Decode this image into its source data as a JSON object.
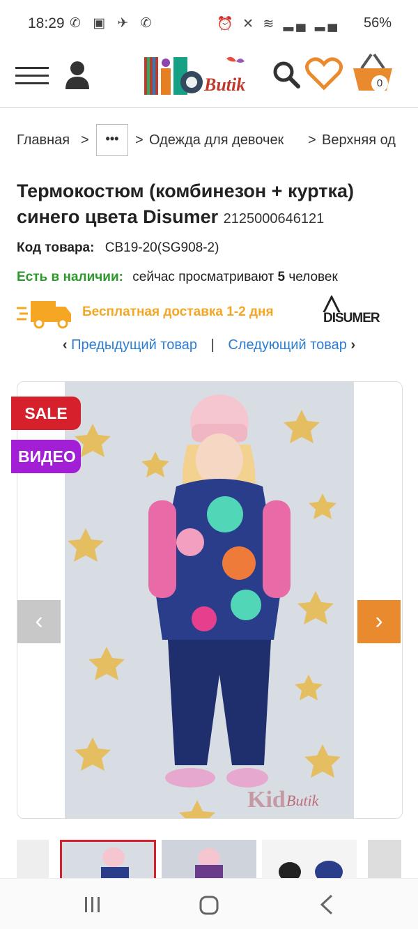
{
  "status": {
    "time": "18:29",
    "battery": "56%"
  },
  "header": {
    "logo_text_kid": "Kid",
    "logo_text_butik": "Butik",
    "cart_count": "0"
  },
  "breadcrumb": {
    "home": "Главная",
    "sep": ">",
    "dots": "•••",
    "girls": "Одежда для девочек",
    "outer": "Верхняя од"
  },
  "product": {
    "title": "Термокостюм (комбинезон + куртка) синего цвета Disumer",
    "sku": "2125000646121",
    "code_label": "Код товара:",
    "code_value": "CB19-20(SG908-2)",
    "stock_label": "Есть в наличии:",
    "viewers_pre": "сейчас просматривают",
    "viewers_count": "5",
    "viewers_post": "человек",
    "delivery": "Бесплатная доставка 1-2 дня",
    "brand": "DISUMER"
  },
  "nav": {
    "prev": "Предыдущий товар",
    "divider": "|",
    "next": "Следующий товар"
  },
  "gallery": {
    "sale": "SALE",
    "video": "ВИДЕО",
    "prev_arrow": "‹",
    "next_arrow": "›",
    "watermark_kid": "Kid",
    "watermark_butik": "Butik"
  },
  "colors": {
    "accent_orange": "#ea8a2e",
    "sale_red": "#d6202b",
    "video_purple": "#a21fd6",
    "link_blue": "#2d7dd2",
    "stock_green": "#2b9a2b",
    "delivery_yellow": "#f5a623"
  }
}
